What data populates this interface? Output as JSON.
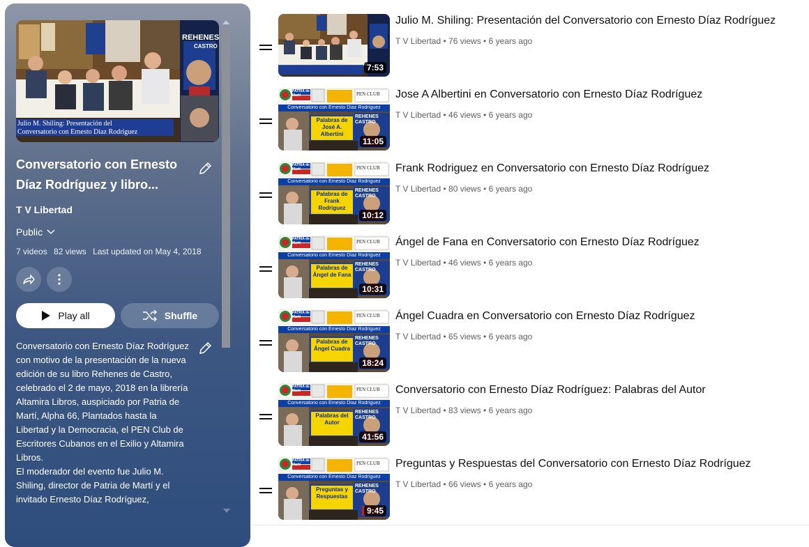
{
  "playlist": {
    "title": "Conversatorio con Ernesto Díaz Rodríguez y libro...",
    "owner": "T V Libertad",
    "privacy": "Public",
    "video_count": "7 videos",
    "views": "82 views",
    "updated": "Last updated on May 4, 2018",
    "play_all": "Play all",
    "shuffle": "Shuffle",
    "hero_caption_line1": "Julio M. Shiling: Presentación del",
    "hero_caption_line2": "Conversatorio con Ernesto Díaz Rodríguez",
    "hero_book_title": "REHENES",
    "hero_book_sub": "CASTRO",
    "description": [
      "Conversatorio con Ernesto Díaz Rodríguez con motivo de la presentación de la nueva edición de su libro Rehenes de Castro, celebrado el 2 de mayo, 2018 en la librería Altamira Libros, auspiciado por Patria de Martí, Alpha 66, Plantados hasta la Libertad y la Democracia, el PEN Club de Escritores Cubanos en el Exilio y Altamira Libros.",
      "El moderador del evento fue Julio M. Shiling, director de Patria de Martí y el invitado Ernesto Díaz Rodríguez,"
    ]
  },
  "videos": [
    {
      "title": "Julio M. Shiling: Presentación del Conversatorio con Ernesto Díaz Rodríguez",
      "channel": "T V Libertad",
      "views": "76 views",
      "age": "6 years ago",
      "duration": "7:53",
      "thumb_label": "",
      "thumb_style": "hero"
    },
    {
      "title": "Jose A Albertini en Conversatorio con Ernesto Díaz Rodríguez",
      "channel": "T V Libertad",
      "views": "46 views",
      "age": "6 years ago",
      "duration": "11:05",
      "thumb_label": "Palabras de José A. Albertini",
      "thumb_style": "banner"
    },
    {
      "title": "Frank Rodriguez en Conversatorio con Ernesto Díaz Rodríguez",
      "channel": "T V Libertad",
      "views": "80 views",
      "age": "6 years ago",
      "duration": "10:12",
      "thumb_label": "Palabras de Frank Rodriguez",
      "thumb_style": "banner"
    },
    {
      "title": "Ángel de Fana en Conversatorio con Ernesto Díaz Rodríguez",
      "channel": "T V Libertad",
      "views": "46 views",
      "age": "6 years ago",
      "duration": "10:31",
      "thumb_label": "Palabras de Ángel de Fana",
      "thumb_style": "banner"
    },
    {
      "title": "Ángel Cuadra en Conversatorio con Ernesto Díaz Rodríguez",
      "channel": "T V Libertad",
      "views": "65 views",
      "age": "6 years ago",
      "duration": "18:24",
      "thumb_label": "Palabras de Ángel Cuadra",
      "thumb_style": "banner"
    },
    {
      "title": "Conversatorio con Ernesto Díaz Rodríguez: Palabras del Autor",
      "channel": "T V Libertad",
      "views": "83 views",
      "age": "6 years ago",
      "duration": "41:56",
      "thumb_label": "Palabras del Autor",
      "thumb_style": "banner"
    },
    {
      "title": "Preguntas y Respuestas del Conversatorio con Ernesto Díaz Rodríguez",
      "channel": "T V Libertad",
      "views": "66 views",
      "age": "6 years ago",
      "duration": "9:45",
      "thumb_label": "Preguntas y Respuestas",
      "thumb_style": "banner"
    }
  ],
  "thumb_banner": {
    "top_text": "Conversatorio con Ernesto Díaz Rodríguez",
    "logo_text": "PATRIA de Martí",
    "pen_text": "PEN CLUB",
    "book_text": "REHENES CASTRO"
  },
  "colors": {
    "panel_top": "#8e97a8",
    "panel_bottom": "#2e4d7d",
    "banner_blue": "#0d3fa3",
    "label_yellow": "#f5d400"
  }
}
